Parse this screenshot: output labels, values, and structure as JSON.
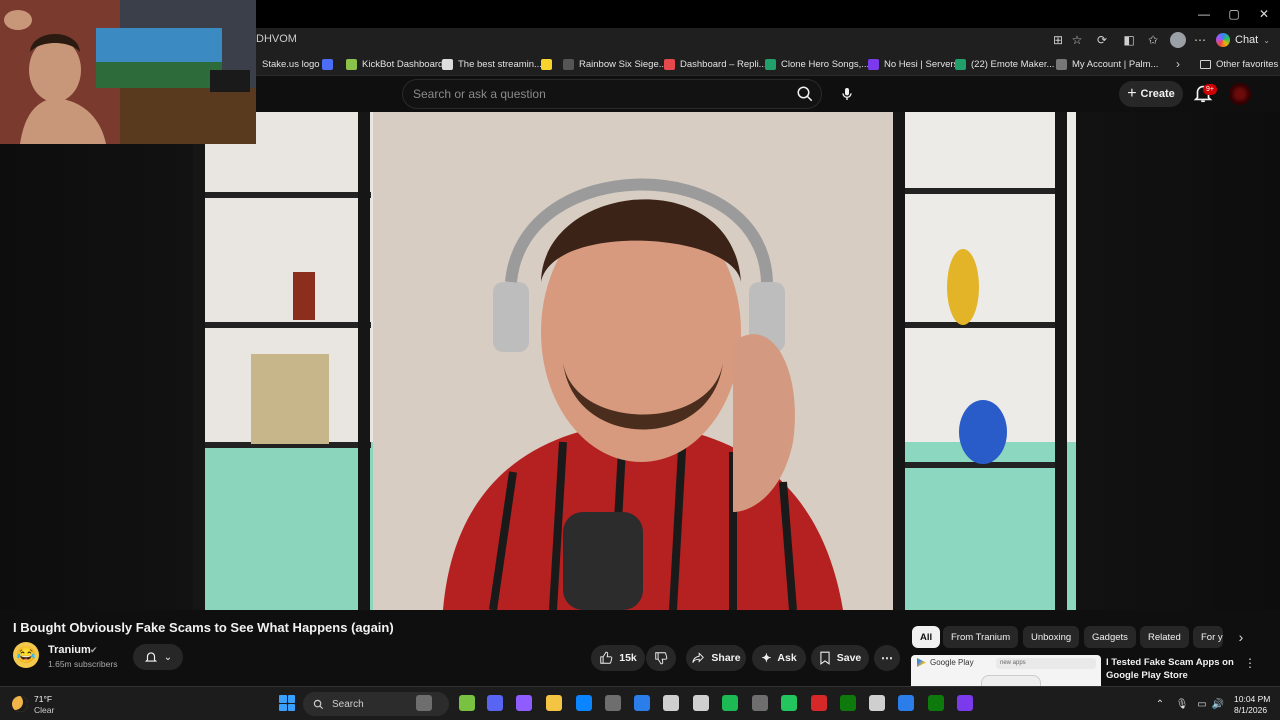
{
  "browser": {
    "url_fragment": "DHVOM",
    "chat_label": "Chat",
    "window_controls": {
      "minimize": "—",
      "maximize": "▢",
      "close": "✕"
    }
  },
  "bookmarks": [
    {
      "label": "Stake.us logo",
      "color": "#1f1f1f"
    },
    {
      "label": "",
      "color": "#4c6ef5"
    },
    {
      "label": "KickBot Dashboard",
      "color": "#8bc34a"
    },
    {
      "label": "The best streamin...",
      "color": "#dddddd"
    },
    {
      "label": "",
      "color": "#f6d32d"
    },
    {
      "label": "Rainbow Six Siege...",
      "color": "#555555"
    },
    {
      "label": "Dashboard – Repli...",
      "color": "#e5484d"
    },
    {
      "label": "Clone Hero Songs,...",
      "color": "#22a06b"
    },
    {
      "label": "No Hesi | Servers",
      "color": "#7c3aed"
    },
    {
      "label": "(22) Emote Maker...",
      "color": "#22a06b"
    },
    {
      "label": "My Account | Palm...",
      "color": "#777777"
    }
  ],
  "other_favorites": "Other favorites",
  "youtube": {
    "search_placeholder": "Search or ask a question",
    "create_label": "Create",
    "notifications_badge": "9+",
    "video": {
      "title": "I Bought Obviously Fake Scams to See What Happens (again)",
      "channel_name": "Tranium",
      "subscribers": "1.65m subscribers",
      "likes": "15k",
      "share_label": "Share",
      "ask_label": "Ask",
      "save_label": "Save"
    },
    "chips": [
      "All",
      "From Tranium",
      "Unboxing",
      "Gadgets",
      "Related",
      "For y"
    ],
    "related": {
      "title": "I Tested Fake Scam Apps on Google Play Store",
      "thumb_header": "Google Play",
      "thumb_search": "new apps"
    }
  },
  "taskbar": {
    "weather_temp": "71°F",
    "weather_desc": "Clear",
    "search_label": "Search",
    "time": "10:04 PM",
    "date": "8/1/2026",
    "app_colors": [
      "#6e6e6e",
      "#79c141",
      "#5865f2",
      "#8e5cff",
      "#f4c542",
      "#0a84ff",
      "#6e6e6e",
      "#2b7de9",
      "#cfcfcf",
      "#cfcfcf",
      "#1db954",
      "#6e6e6e",
      "#22c55e",
      "#d62828",
      "#0e7a0d",
      "#cfcfcf",
      "#2b7de9",
      "#0e7a0d",
      "#7c3aed"
    ]
  }
}
